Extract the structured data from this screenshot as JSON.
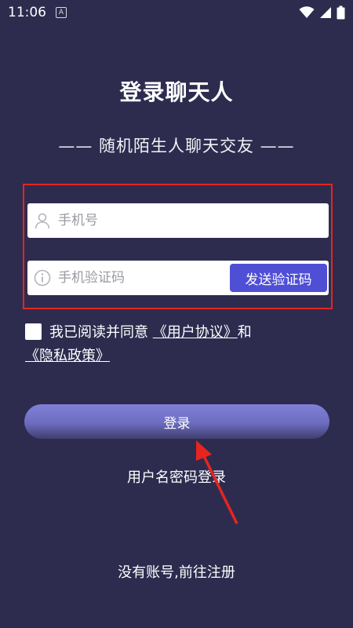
{
  "status_bar": {
    "time": "11:06",
    "notification_icon": "a-icon",
    "notification_label": "A",
    "icons": [
      "wifi-icon",
      "signal-icon",
      "battery-icon"
    ]
  },
  "header": {
    "title": "登录聊天人",
    "subtitle": "—— 随机陌生人聊天交友 ——"
  },
  "form": {
    "phone_placeholder": "手机号",
    "code_placeholder": "手机验证码",
    "send_code_label": "发送验证码",
    "agreement_prefix": "我已阅读并同意",
    "user_agreement": "《用户协议》",
    "and_text": "和",
    "privacy_policy": "《隐私政策》",
    "login_label": "登录"
  },
  "footer": {
    "password_login": "用户名密码登录",
    "register": "没有账号,前往注册"
  },
  "colors": {
    "background": "#2d2c4f",
    "send_button": "#4f4fd6",
    "annotation": "#e8241e"
  }
}
